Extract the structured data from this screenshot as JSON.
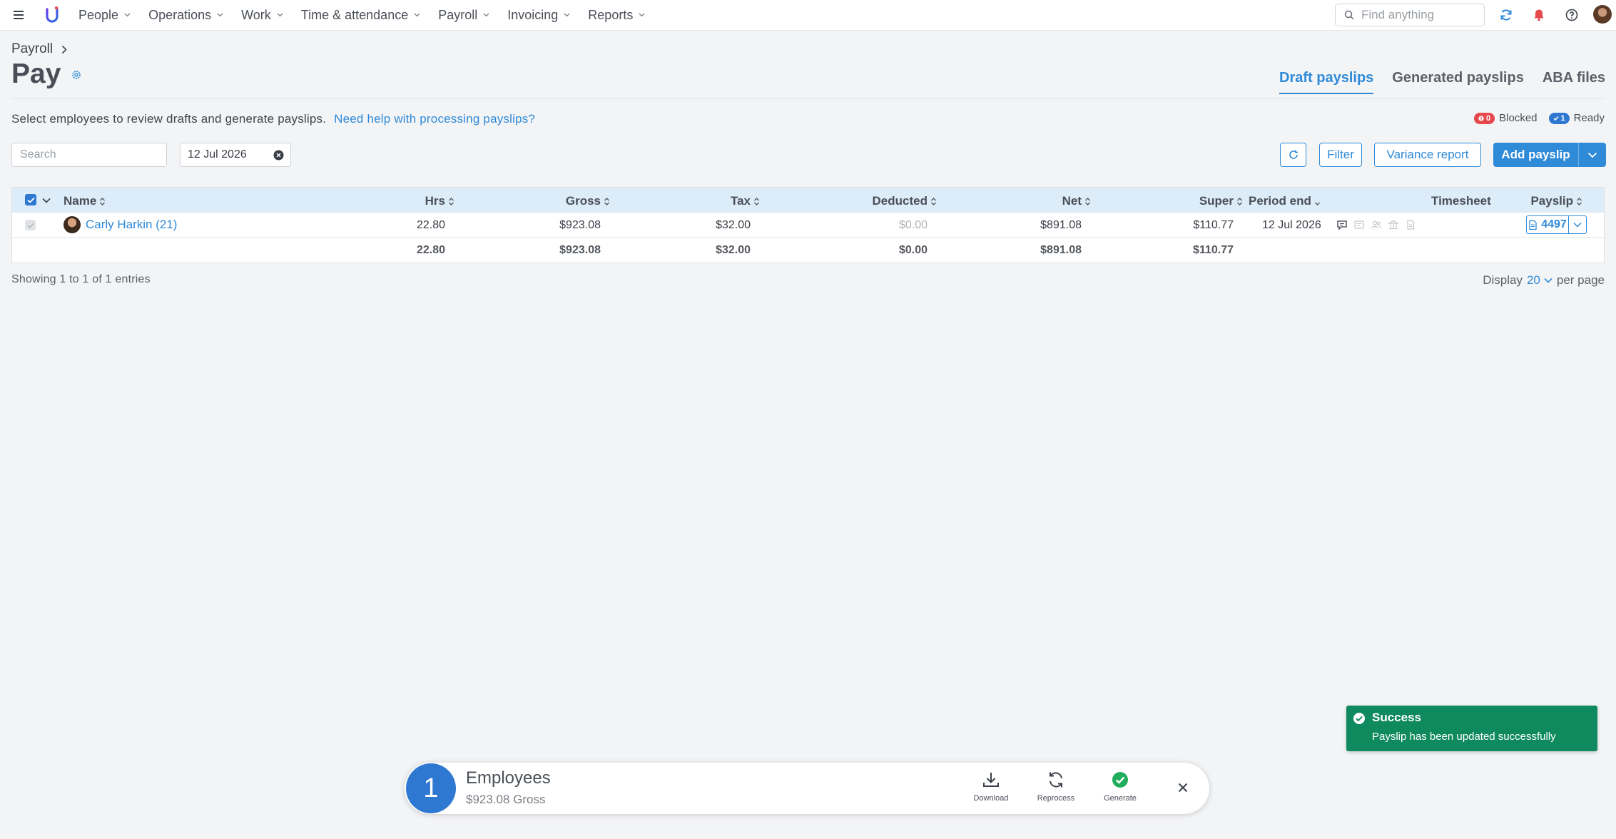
{
  "nav": {
    "items": [
      "People",
      "Operations",
      "Work",
      "Time & attendance",
      "Payroll",
      "Invoicing",
      "Reports"
    ],
    "search_placeholder": "Find anything"
  },
  "header": {
    "breadcrumb": "Payroll",
    "title": "Pay",
    "tabs": [
      "Draft payslips",
      "Generated payslips",
      "ABA files"
    ],
    "active_tab": "Draft payslips"
  },
  "intro": {
    "text": "Select employees to review drafts and generate payslips.",
    "help_link": "Need help with processing payslips?"
  },
  "status": {
    "blocked_count": "0",
    "blocked_label": "Blocked",
    "ready_count": "1",
    "ready_label": "Ready"
  },
  "filters": {
    "search_placeholder": "Search",
    "date": "12 Jul 2026"
  },
  "toolbar": {
    "filter": "Filter",
    "variance_report": "Variance report",
    "add_payslip": "Add payslip"
  },
  "table": {
    "headers": {
      "name": "Name",
      "hrs": "Hrs",
      "gross": "Gross",
      "tax": "Tax",
      "deducted": "Deducted",
      "net": "Net",
      "super": "Super",
      "period_end": "Period end",
      "timesheet": "Timesheet",
      "payslip": "Payslip"
    },
    "rows": [
      {
        "name": "Carly Harkin (21)",
        "hrs": "22.80",
        "gross": "$923.08",
        "tax": "$32.00",
        "deducted": "$0.00",
        "net": "$891.08",
        "super": "$110.77",
        "period_end": "12 Jul 2026",
        "payslip": "4497"
      }
    ],
    "totals": {
      "hrs": "22.80",
      "gross": "$923.08",
      "tax": "$32.00",
      "deducted": "$0.00",
      "net": "$891.08",
      "super": "$110.77"
    }
  },
  "pagination": {
    "showing": "Showing 1 to 1 of 1 entries",
    "display_label": "Display",
    "per_page_value": "20",
    "per_page_label": "per page"
  },
  "toast": {
    "title": "Success",
    "message": "Payslip has been updated successfully"
  },
  "action_bar": {
    "count": "1",
    "title": "Employees",
    "subtitle": "$923.08 Gross",
    "actions": [
      "Download",
      "Reprocess",
      "Generate"
    ]
  },
  "colors": {
    "accent": "#2f8ad8",
    "table_header": "#dcecf8",
    "toast": "#0f8a5f",
    "blocked": "#e5484d",
    "generate": "#1fae5b"
  }
}
